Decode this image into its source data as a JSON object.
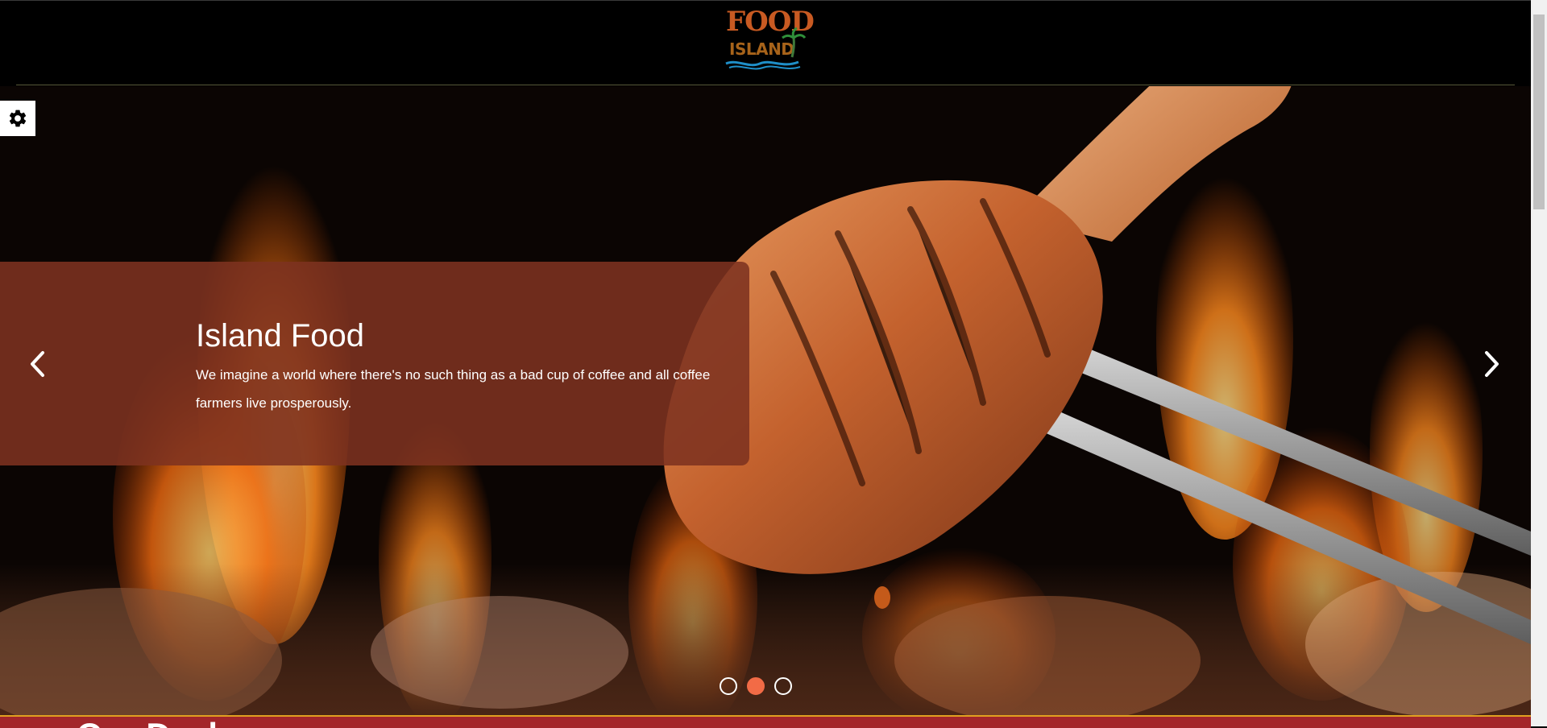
{
  "header": {
    "logo_top": "FOOD",
    "logo_bottom": "ISLAND"
  },
  "slide": {
    "title": "Island Food",
    "text": "We imagine a world where there's no such thing as a bad cup of coffee and all coffee farmers live prosperously."
  },
  "carousel": {
    "slide_count": 3,
    "active_index": 1
  },
  "next_section": {
    "title": "Our Deals"
  },
  "icons": {
    "settings": "gear-icon",
    "prev": "chevron-left-icon",
    "next": "chevron-right-icon"
  },
  "colors": {
    "caption_bg": "#7d3220",
    "accent": "#f26b46",
    "section_bg": "#a3262a"
  }
}
